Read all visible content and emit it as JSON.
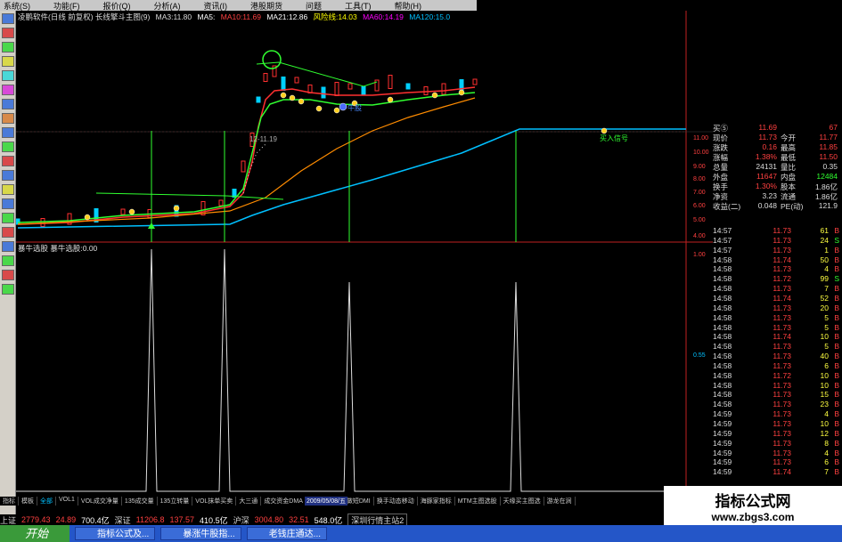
{
  "menubar": {
    "items": [
      "系统(S)",
      "功能(F)",
      "报价(Q)",
      "分析(A)",
      "资讯(I)",
      "港股期货",
      "问题",
      "工具(T)",
      "帮助(H)"
    ]
  },
  "info": {
    "title": "凌鹏软件(日线 前复权) 长线擎斗主图(9)",
    "ma3": "MA3:11.80",
    "ma5": "MA5:",
    "ma10": "MA10:11.69",
    "ma21": "MA21:12.86",
    "note": "风险线:14.03",
    "ma60": "MA60:14.19",
    "ma120": "MA120:15.0"
  },
  "sub": {
    "title": "暴牛选股 暴牛选股:0.00"
  },
  "annotations": {
    "price_label": "12-11.19",
    "niu": "牛股",
    "buy": "买入信号"
  },
  "axis": {
    "labels": [
      "11.00",
      "10.00",
      "9.00",
      "8.00",
      "7.00",
      "6.00",
      "5.00",
      "4.00",
      "1.00",
      "0.55"
    ]
  },
  "quote": {
    "rows": [
      {
        "l": "买⑤",
        "v": "11.69",
        "l2": "",
        "v2": "67"
      },
      {
        "l": "现价",
        "v": "11.73",
        "l2": "今开",
        "v2": "11.77"
      },
      {
        "l": "涨跌",
        "v": "0.16",
        "l2": "最高",
        "v2": "11.85"
      },
      {
        "l": "涨幅",
        "v": "1.38%",
        "l2": "最低",
        "v2": "11.50"
      },
      {
        "l": "总量",
        "v": "24131",
        "l2": "量比",
        "v2": "0.35"
      },
      {
        "l": "外盘",
        "v": "11647",
        "l2": "内盘",
        "v2": "12484"
      },
      {
        "l": "换手",
        "v": "1.30%",
        "l2": "股本",
        "v2": "1.86亿"
      },
      {
        "l": "净资",
        "v": "3.23",
        "l2": "流通",
        "v2": "1.86亿"
      },
      {
        "l": "收益(二)",
        "v": "0.048",
        "l2": "PE(动)",
        "v2": "121.9"
      }
    ]
  },
  "ticks": [
    {
      "t": "14:57",
      "p": "11.73",
      "q": "61",
      "f": "B"
    },
    {
      "t": "14:57",
      "p": "11.73",
      "q": "24",
      "f": "S"
    },
    {
      "t": "14:57",
      "p": "11.73",
      "q": "1",
      "f": "B"
    },
    {
      "t": "14:58",
      "p": "11.74",
      "q": "50",
      "f": "B"
    },
    {
      "t": "14:58",
      "p": "11.73",
      "q": "4",
      "f": "B"
    },
    {
      "t": "14:58",
      "p": "11.72",
      "q": "99",
      "f": "S"
    },
    {
      "t": "14:58",
      "p": "11.73",
      "q": "7",
      "f": "B"
    },
    {
      "t": "14:58",
      "p": "11.74",
      "q": "52",
      "f": "B"
    },
    {
      "t": "14:58",
      "p": "11.73",
      "q": "20",
      "f": "B"
    },
    {
      "t": "14:58",
      "p": "11.73",
      "q": "5",
      "f": "B"
    },
    {
      "t": "14:58",
      "p": "11.73",
      "q": "5",
      "f": "B"
    },
    {
      "t": "14:58",
      "p": "11.74",
      "q": "10",
      "f": "B"
    },
    {
      "t": "14:58",
      "p": "11.73",
      "q": "5",
      "f": "B"
    },
    {
      "t": "14:58",
      "p": "11.73",
      "q": "40",
      "f": "B"
    },
    {
      "t": "14:58",
      "p": "11.73",
      "q": "6",
      "f": "B"
    },
    {
      "t": "14:58",
      "p": "11.72",
      "q": "10",
      "f": "B"
    },
    {
      "t": "14:58",
      "p": "11.73",
      "q": "10",
      "f": "B"
    },
    {
      "t": "14:58",
      "p": "11.73",
      "q": "15",
      "f": "B"
    },
    {
      "t": "14:58",
      "p": "11.73",
      "q": "23",
      "f": "B"
    },
    {
      "t": "14:59",
      "p": "11.73",
      "q": "4",
      "f": "B"
    },
    {
      "t": "14:59",
      "p": "11.73",
      "q": "10",
      "f": "B"
    },
    {
      "t": "14:59",
      "p": "11.73",
      "q": "12",
      "f": "B"
    },
    {
      "t": "14:59",
      "p": "11.73",
      "q": "8",
      "f": "B"
    },
    {
      "t": "14:59",
      "p": "11.73",
      "q": "4",
      "f": "B"
    },
    {
      "t": "14:59",
      "p": "11.73",
      "q": "6",
      "f": "B"
    },
    {
      "t": "14:59",
      "p": "11.74",
      "q": "7",
      "f": "B"
    }
  ],
  "bottom_tabs": [
    "指标",
    "模板",
    "全部",
    "VOL1",
    "VOL成交净量",
    "135成交量",
    "135立转量",
    "VOL抹单买卖",
    "大三通",
    "成交资金DMA",
    "黄金线",
    "看长做短DMI",
    "换手动态移动",
    "海豚家指标",
    "MTM主图选股",
    "天缘买主图选",
    "游龙在涧"
  ],
  "date_box": "2009/05/08/五",
  "status": {
    "sh_label": "上证",
    "sh_value": "2779.43",
    "sh_change": "24.89",
    "sh_amount": "700.4亿",
    "sz_label": "深证",
    "sz_value": "11206.8",
    "sz_change": "137.57",
    "sz_amount": "410.5亿",
    "hs_label": "沪深",
    "hs_value": "3004.80",
    "hs_change": "32.51",
    "hs_amount": "548.0亿",
    "right": "深圳行情主站2"
  },
  "taskbar": {
    "start": "开始",
    "tasks": [
      "指标公式及...",
      "暴涨牛股指...",
      "老钱庄通达..."
    ]
  },
  "watermark": {
    "line1": "指标公式网",
    "line2": "www.zbgs3.com"
  },
  "colors": {
    "up": "#ff4040",
    "ma5": "#ffffff",
    "ma10": "#ffff00",
    "ma21": "#ff00ff",
    "ma60": "#ff8c00",
    "ma120": "#00c0ff"
  }
}
